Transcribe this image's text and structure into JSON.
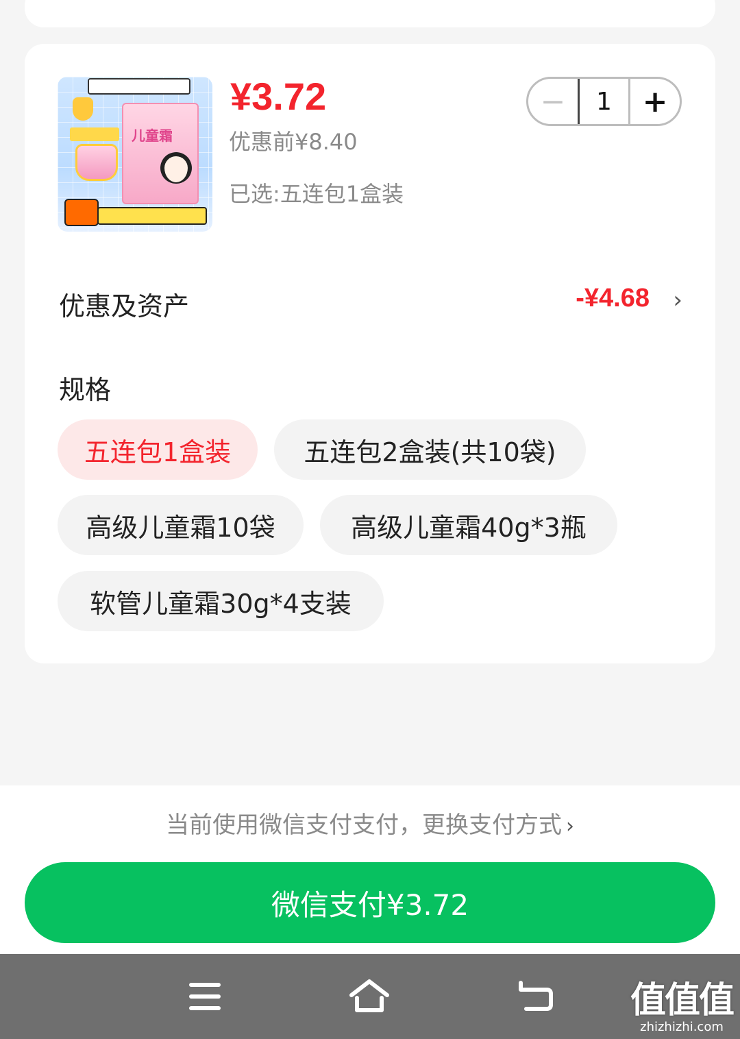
{
  "product": {
    "price": "¥3.72",
    "original_price": "优惠前¥8.40",
    "selected": "已选:五连包1盒装",
    "quantity": "1",
    "image_label": "儿童霜"
  },
  "stepper": {
    "minus": "−",
    "plus": "+"
  },
  "discount": {
    "label": "优惠及资产",
    "value": "-¥4.68",
    "chevron": "›"
  },
  "spec": {
    "title": "规格",
    "options": [
      {
        "label": "五连包1盒装",
        "active": true
      },
      {
        "label": "五连包2盒装(共10袋)",
        "active": false
      },
      {
        "label": "高级儿童霜10袋",
        "active": false
      },
      {
        "label": "高级儿童霜40g*3瓶",
        "active": false
      },
      {
        "label": "软管儿童霜30g*4支装",
        "active": false
      }
    ]
  },
  "payment": {
    "note": "当前使用微信支付支付，更换支付方式",
    "note_chevron": "›",
    "button": "微信支付¥3.72"
  },
  "watermark": {
    "big": "值值值",
    "small": "zhizhizhi.com"
  },
  "colors": {
    "price_red": "#f3242d",
    "pay_green": "#07c160",
    "chip_active_bg": "#fde8e8"
  }
}
